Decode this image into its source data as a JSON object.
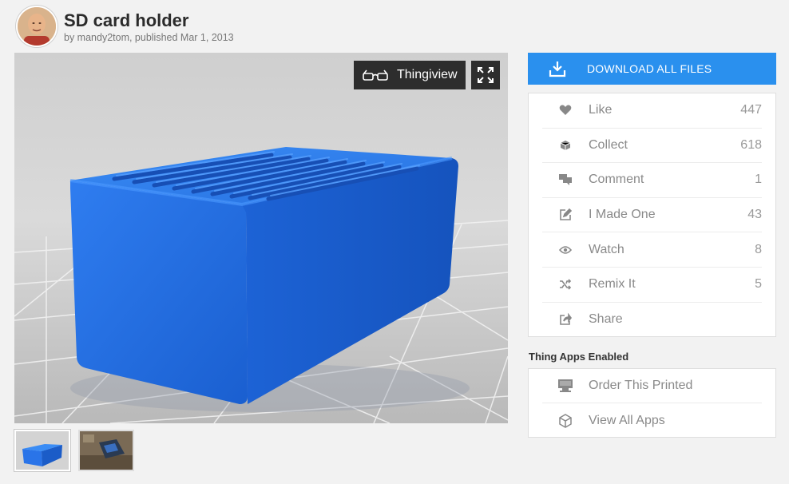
{
  "thing": {
    "title": "SD card holder",
    "byline": "by mandy2tom, published Mar 1, 2013"
  },
  "viewer": {
    "thingiview_label": "Thingiview"
  },
  "download": {
    "label": "DOWNLOAD ALL FILES"
  },
  "actions": [
    {
      "label": "Like",
      "count": "447",
      "icon": "heart-icon"
    },
    {
      "label": "Collect",
      "count": "618",
      "icon": "collect-icon"
    },
    {
      "label": "Comment",
      "count": "1",
      "icon": "comment-icon"
    },
    {
      "label": "I Made One",
      "count": "43",
      "icon": "edit-icon"
    },
    {
      "label": "Watch",
      "count": "8",
      "icon": "eye-icon"
    },
    {
      "label": "Remix It",
      "count": "5",
      "icon": "shuffle-icon"
    },
    {
      "label": "Share",
      "count": "",
      "icon": "share-icon"
    }
  ],
  "apps": {
    "title": "Thing Apps Enabled",
    "items": [
      {
        "label": "Order This Printed",
        "icon": "printer-icon"
      },
      {
        "label": "View All Apps",
        "icon": "cube-icon"
      }
    ]
  },
  "colors": {
    "accent": "#2a90ee",
    "model_blue": "#1e6fdc",
    "dark_button": "#2d2d2d"
  }
}
